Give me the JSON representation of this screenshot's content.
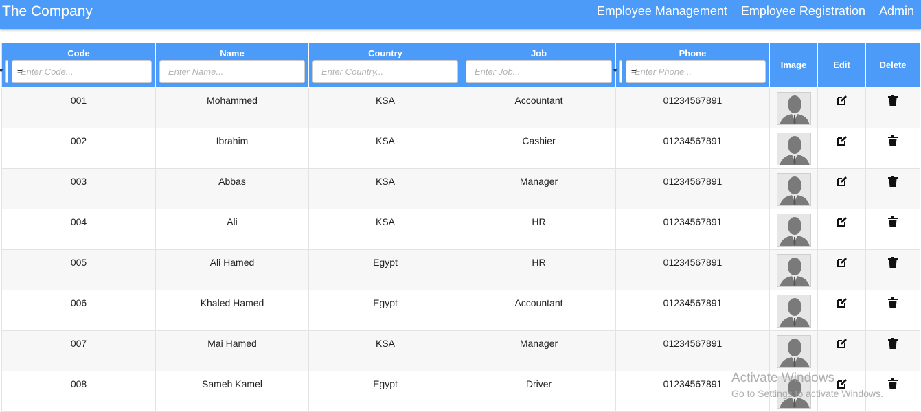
{
  "app": {
    "brand": "The Company"
  },
  "nav": {
    "items": [
      "Employee Management",
      "Employee Registration",
      "Admin"
    ]
  },
  "table": {
    "columns": {
      "code": "Code",
      "name": "Name",
      "country": "Country",
      "job": "Job",
      "phone": "Phone",
      "image": "Image",
      "edit": "Edit",
      "delete": "Delete"
    },
    "filters": {
      "code_operator": "=",
      "code_placeholder": "Enter Code...",
      "name_placeholder": "Enter Name...",
      "country_placeholder": "Enter Country...",
      "job_placeholder": "Enter Job...",
      "phone_operator": "=",
      "phone_placeholder": "Enter Phone..."
    },
    "rows": [
      {
        "code": "001",
        "name": "Mohammed",
        "country": "KSA",
        "job": "Accountant",
        "phone": "01234567891"
      },
      {
        "code": "002",
        "name": "Ibrahim",
        "country": "KSA",
        "job": "Cashier",
        "phone": "01234567891"
      },
      {
        "code": "003",
        "name": "Abbas",
        "country": "KSA",
        "job": "Manager",
        "phone": "01234567891"
      },
      {
        "code": "004",
        "name": "Ali",
        "country": "KSA",
        "job": "HR",
        "phone": "01234567891"
      },
      {
        "code": "005",
        "name": "Ali Hamed",
        "country": "Egypt",
        "job": "HR",
        "phone": "01234567891"
      },
      {
        "code": "006",
        "name": "Khaled Hamed",
        "country": "Egypt",
        "job": "Accountant",
        "phone": "01234567891"
      },
      {
        "code": "007",
        "name": "Mai Hamed",
        "country": "KSA",
        "job": "Manager",
        "phone": "01234567891"
      },
      {
        "code": "008",
        "name": "Sameh Kamel",
        "country": "Egypt",
        "job": "Driver",
        "phone": "01234567891"
      }
    ]
  },
  "icons": {
    "edit": "edit-icon",
    "delete": "trash-icon",
    "avatar": "person-silhouette"
  },
  "watermark": {
    "line1": "Activate Windows",
    "line2": "Go to Settings to activate Windows."
  },
  "colors": {
    "primary": "#4d9bf9",
    "row_alt": "#f7f7f7"
  }
}
